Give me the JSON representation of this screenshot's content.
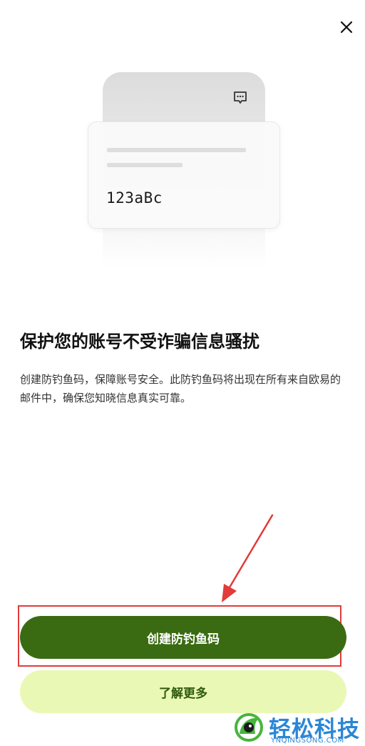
{
  "header": {
    "close_icon": "close-icon"
  },
  "illustration": {
    "chat_icon": "chat-bubble-icon",
    "sample_code": "123aBc"
  },
  "content": {
    "title": "保护您的账号不受诈骗信息骚扰",
    "description": "创建防钓鱼码，保障账号安全。此防钓鱼码将出现在所有来自欧易的邮件中，确保您知晓信息真实可靠。"
  },
  "actions": {
    "primary_label": "创建防钓鱼码",
    "secondary_label": "了解更多"
  },
  "annotation": {
    "color": "#e23b3b"
  },
  "watermark": {
    "text": "轻松科技",
    "subtext": "YNQINGSONG.COM"
  },
  "colors": {
    "primary_button": "#3a6b12",
    "secondary_button": "#e9f8b4",
    "secondary_text": "#2f5a0c",
    "watermark": "#2a86d6"
  }
}
